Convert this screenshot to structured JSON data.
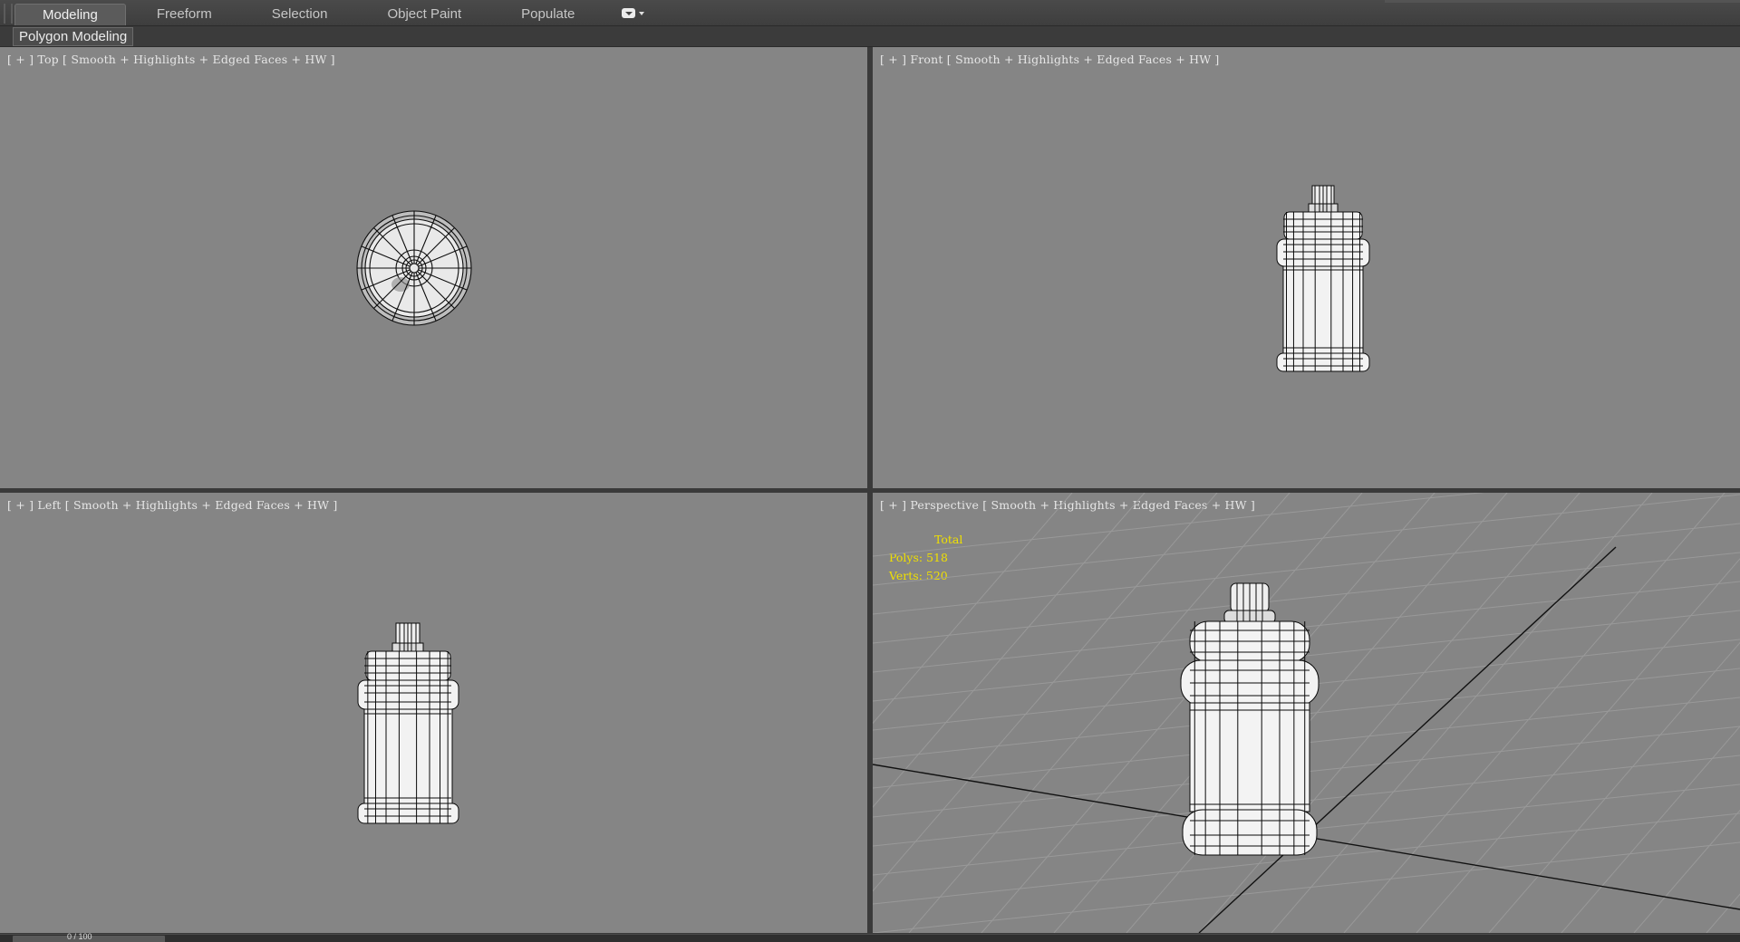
{
  "ribbon": {
    "tabs": [
      {
        "label": "Modeling",
        "active": true
      },
      {
        "label": "Freeform",
        "active": false
      },
      {
        "label": "Selection",
        "active": false
      },
      {
        "label": "Object Paint",
        "active": false
      },
      {
        "label": "Populate",
        "active": false
      }
    ],
    "options_icon": "ribbon-options-icon"
  },
  "panel": {
    "label": "Polygon Modeling"
  },
  "viewports": {
    "top": {
      "open": "[ + ]",
      "view": "Top",
      "shading": "Smooth + Highlights + Edged Faces + HW ]"
    },
    "front": {
      "open": "[ + ]",
      "view": "Front",
      "shading": "Smooth + Highlights + Edged Faces + HW ]"
    },
    "left": {
      "open": "[ + ]",
      "view": "Left",
      "shading": "Smooth + Highlights + Edged Faces + HW ]"
    },
    "perspective": {
      "open": "[ + ]",
      "view": "Perspective",
      "shading": "Smooth + Highlights + Edged Faces + HW ]",
      "stats": {
        "title": "Total",
        "polys": "Polys: 518",
        "verts": "Verts: 520"
      }
    }
  },
  "timeline": {
    "frame": "0 / 100"
  },
  "colors": {
    "viewport_bg": "#858585",
    "stats_text": "#f0e000",
    "active_tab": "#5b5b5b"
  }
}
